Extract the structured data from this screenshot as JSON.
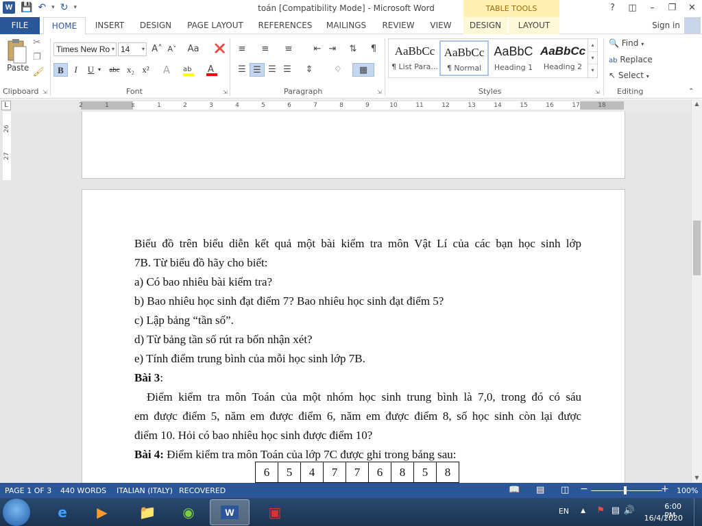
{
  "titlebar": {
    "title": "toán [Compatibility Mode] - Microsoft Word",
    "word_logo": "W",
    "table_tools": "TABLE TOOLS",
    "help": "?",
    "icons": [
      "save-icon",
      "undo-icon",
      "redo-icon",
      "customize-qat-icon"
    ]
  },
  "tabs": {
    "file": "FILE",
    "home": "HOME",
    "insert": "INSERT",
    "design": "DESIGN",
    "page_layout": "PAGE LAYOUT",
    "references": "REFERENCES",
    "mailings": "MAILINGS",
    "review": "REVIEW",
    "view": "VIEW",
    "tt_design": "DESIGN",
    "tt_layout": "LAYOUT",
    "sign_in": "Sign in"
  },
  "ribbon": {
    "clipboard": {
      "paste": "Paste",
      "label": "Clipboard"
    },
    "font": {
      "name": "Times New Ro",
      "size": "14",
      "grow": "A˄",
      "shrink": "A˅",
      "case": "Aa",
      "bold": "B",
      "italic": "I",
      "underline": "U",
      "strike": "abc",
      "sub": "x₂",
      "sup": "x²",
      "label": "Font",
      "highlight_color": "#ffff00",
      "font_color": "#ff0000"
    },
    "paragraph": {
      "label": "Paragraph",
      "pilcrow": "¶"
    },
    "styles": {
      "label": "Styles",
      "items": [
        {
          "sample": "AaBbCc",
          "name": "¶ List Para..."
        },
        {
          "sample": "AaBbCc",
          "name": "¶ Normal"
        },
        {
          "sample": "AaBbC",
          "name": "Heading 1"
        },
        {
          "sample": "AaBbCc",
          "name": "Heading 2"
        }
      ]
    },
    "editing": {
      "find": "Find",
      "replace": "Replace",
      "select": "Select",
      "label": "Editing"
    }
  },
  "ruler": {
    "h_marks": [
      "2",
      "1",
      "1",
      "2",
      "3",
      "4",
      "5",
      "6",
      "7",
      "8",
      "9",
      "10",
      "11",
      "12",
      "13",
      "14",
      "15",
      "16",
      "17",
      "18"
    ],
    "v_marks": [
      "26",
      "27"
    ],
    "corner": "L"
  },
  "document": {
    "lines": [
      "Biểu đồ trên biểu diễn kết quả một bài kiểm tra môn Vật Lí của các bạn học sinh lớp",
      "7B. Từ biểu đồ hãy cho biết:",
      "a) Có bao nhiêu bài kiểm tra?",
      "b) Bao nhiêu học sinh đạt điểm 7? Bao nhiêu học sinh đạt điểm 5?",
      "c) Lập bảng “tần số”.",
      "d) Từ bảng tần số rút ra bốn nhận xét?",
      "e) Tính điểm trung bình của mỗi học sinh lớp 7B."
    ],
    "bai3_title": "Bài 3",
    "bai3_colon": ":",
    "bai3_lines": [
      "Điểm kiểm tra môn Toán của một nhóm học sinh trung bình là 7,0, trong đó có sáu",
      "em được điểm 5, năm em được điểm 6, năm em được điểm 8, số học sinh còn lại được",
      "điểm 10. Hỏi có bao nhiêu học sinh được điểm 10?"
    ],
    "bai4_title": "Bài 4:",
    "bai4_text": " Điểm kiểm tra môn Toán của lớp 7C được ghi trong bảng sau:",
    "score_row": [
      "6",
      "5",
      "4",
      "7",
      "7",
      "6",
      "8",
      "5",
      "8"
    ]
  },
  "statusbar": {
    "page": "PAGE 1 OF 3",
    "words": "440 WORDS",
    "language": "ITALIAN (ITALY)",
    "recovered": "RECOVERED",
    "zoom": "100%",
    "zoom_minus": "−",
    "zoom_plus": "+",
    "zoom_level": 0.48
  },
  "taskbar": {
    "lang": "EN",
    "time": "6:00 PM",
    "date": "16/4/2020"
  }
}
